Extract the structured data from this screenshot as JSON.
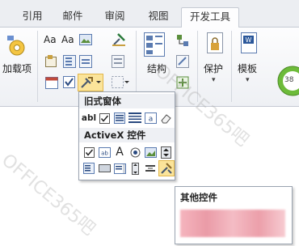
{
  "tabs": [
    {
      "label": "引用",
      "active": false
    },
    {
      "label": "邮件",
      "active": false
    },
    {
      "label": "审阅",
      "active": false
    },
    {
      "label": "视图",
      "active": false
    },
    {
      "label": "开发工具",
      "active": true
    }
  ],
  "ribbon": {
    "addins_label": "加载项",
    "structure_label": "结构",
    "protect_label": "保护",
    "template_label": "模板",
    "zoom_badge": "38"
  },
  "dropdown": {
    "legacy_title": "旧式窗体",
    "activex_title": "ActiveX 控件",
    "legacy_text_glyph": "abl"
  },
  "tooltip": {
    "title": "其他控件"
  },
  "watermark": "OFFICE365吧"
}
